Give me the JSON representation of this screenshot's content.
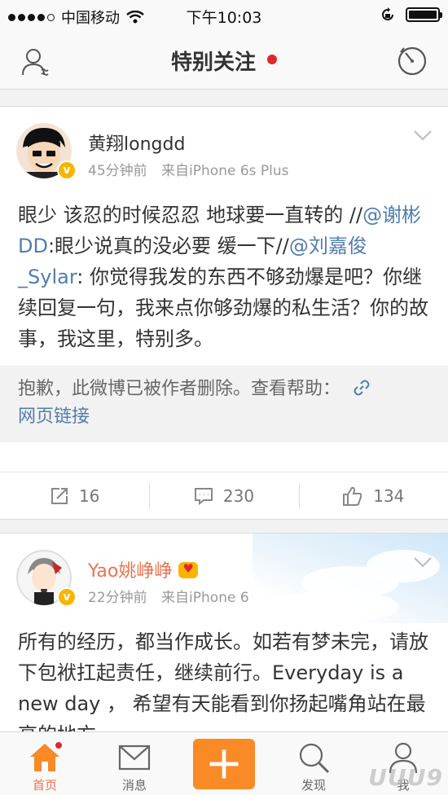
{
  "status_bar": {
    "carrier": "中国移动",
    "time": "下午10:03"
  },
  "nav": {
    "title": "特别关注",
    "left_icon": "add-friend-icon",
    "right_icon": "radar-icon",
    "dot_color": "#e3262c"
  },
  "posts": [
    {
      "user_name": "黄翔longdd",
      "time": "45分钟前",
      "source": "来自iPhone 6s Plus",
      "text_parts": {
        "p1": "眼少 该忍的时候忍忍 地球要一直转的 //",
        "m1": "@谢彬DD",
        "p2": ":眼少说真的没必要 缓一下//",
        "m2": "@刘嘉俊_Sylar",
        "p3": ": 你觉得我发的东西不够劲爆是吧？你继续回复一句，我来点你够劲爆的私生活？你的故事，我这里，特别多。"
      },
      "deleted_notice": "抱歉，此微博已被作者删除。查看帮助：",
      "deleted_link": "网页链接",
      "reposts": "16",
      "comments": "230",
      "likes": "134"
    },
    {
      "user_name": "Yao姚峥峥",
      "time": "22分钟前",
      "source": "来自iPhone 6",
      "text": "所有的经历，都当作成长。如若有梦未完，请放下包袱扛起责任，继续前行。Everyday is a new day ， 希望有天能看到你扬起嘴角站在最高的地方。"
    }
  ],
  "tabs": [
    {
      "label": "首页",
      "icon": "home-icon"
    },
    {
      "label": "消息",
      "icon": "message-icon"
    },
    {
      "label": "",
      "icon": "plus-icon"
    },
    {
      "label": "发现",
      "icon": "discover-icon"
    },
    {
      "label": "我",
      "icon": "profile-icon"
    }
  ],
  "watermark": "UUU9",
  "colors": {
    "accent_orange": "#eb7350",
    "link_blue": "#507daf",
    "compose_orange": "#f98a26"
  }
}
